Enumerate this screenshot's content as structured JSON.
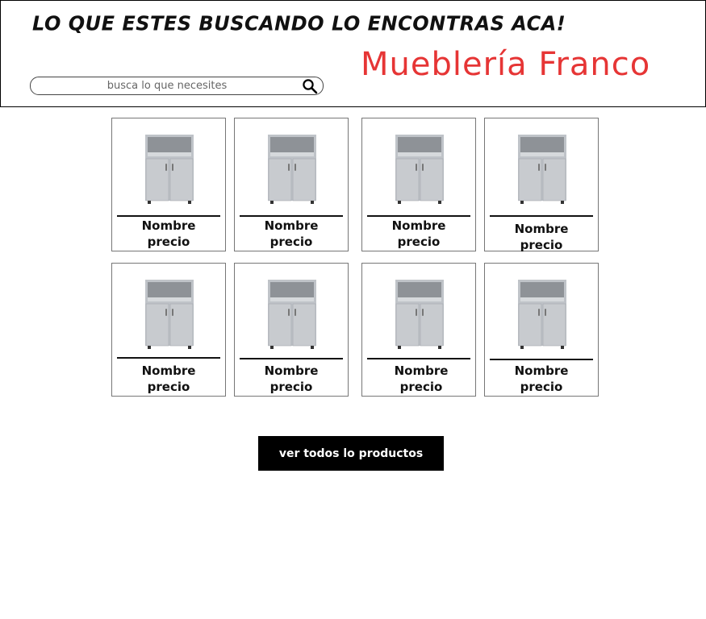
{
  "header": {
    "tagline": "LO QUE ESTES BUSCANDO LO ENCONTRAS ACA!",
    "brand": "Mueblería Franco",
    "brand_color": "#e63535"
  },
  "search": {
    "placeholder": "busca lo que necesites",
    "value": "",
    "icon": "search-icon"
  },
  "products": [
    {
      "name": "Nombre",
      "price": "precio",
      "image": "cabinet-image"
    },
    {
      "name": "Nombre",
      "price": "precio",
      "image": "cabinet-image"
    },
    {
      "name": "Nombre",
      "price": "precio",
      "image": "cabinet-image"
    },
    {
      "name": "Nombre",
      "price": "precio",
      "image": "cabinet-image"
    },
    {
      "name": "Nombre",
      "price": "precio",
      "image": "cabinet-image"
    },
    {
      "name": "Nombre",
      "price": "precio",
      "image": "cabinet-image"
    },
    {
      "name": "Nombre",
      "price": "precio",
      "image": "cabinet-image"
    },
    {
      "name": "Nombre",
      "price": "precio",
      "image": "cabinet-image"
    }
  ],
  "cta": {
    "label": "ver todos lo productos"
  }
}
